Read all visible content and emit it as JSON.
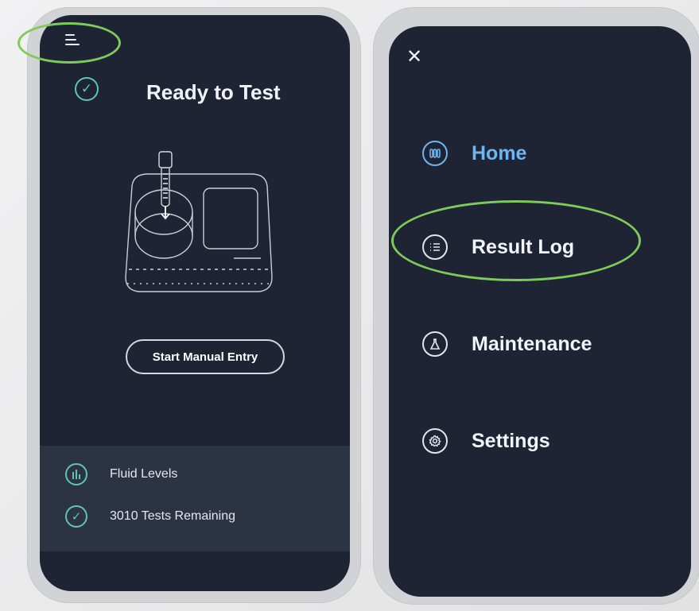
{
  "left_screen": {
    "status": {
      "title": "Ready to Test",
      "icon": "check-circle-icon"
    },
    "menu_icon": "hamburger-menu-icon",
    "manual_entry_label": "Start Manual Entry",
    "bottom_panel": [
      {
        "icon": "bar-chart-icon",
        "label": "Fluid Levels"
      },
      {
        "icon": "check-circle-icon",
        "label": "3010 Tests Remaining"
      }
    ]
  },
  "right_screen": {
    "close_icon": "close-icon",
    "menu": [
      {
        "label": "Home",
        "icon": "test-tubes-icon",
        "active": true
      },
      {
        "label": "Result Log",
        "icon": "list-icon",
        "active": false
      },
      {
        "label": "Maintenance",
        "icon": "flask-icon",
        "active": false
      },
      {
        "label": "Settings",
        "icon": "gear-icon",
        "active": false
      }
    ]
  },
  "colors": {
    "screen_bg": "#1e2434",
    "panel_bg": "#2c3444",
    "accent_teal": "#5fc4b6",
    "active_blue": "#6fb5ef",
    "highlight_green": "#7ecb5a"
  }
}
